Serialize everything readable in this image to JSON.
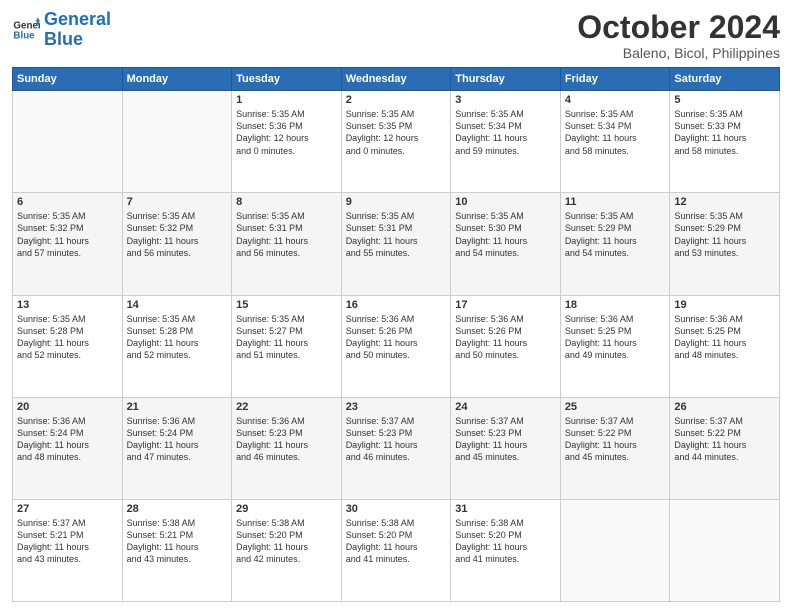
{
  "header": {
    "logo_line1": "General",
    "logo_line2": "Blue",
    "month": "October 2024",
    "location": "Baleno, Bicol, Philippines"
  },
  "weekdays": [
    "Sunday",
    "Monday",
    "Tuesday",
    "Wednesday",
    "Thursday",
    "Friday",
    "Saturday"
  ],
  "weeks": [
    [
      {
        "day": "",
        "text": ""
      },
      {
        "day": "",
        "text": ""
      },
      {
        "day": "1",
        "text": "Sunrise: 5:35 AM\nSunset: 5:36 PM\nDaylight: 12 hours\nand 0 minutes."
      },
      {
        "day": "2",
        "text": "Sunrise: 5:35 AM\nSunset: 5:35 PM\nDaylight: 12 hours\nand 0 minutes."
      },
      {
        "day": "3",
        "text": "Sunrise: 5:35 AM\nSunset: 5:34 PM\nDaylight: 11 hours\nand 59 minutes."
      },
      {
        "day": "4",
        "text": "Sunrise: 5:35 AM\nSunset: 5:34 PM\nDaylight: 11 hours\nand 58 minutes."
      },
      {
        "day": "5",
        "text": "Sunrise: 5:35 AM\nSunset: 5:33 PM\nDaylight: 11 hours\nand 58 minutes."
      }
    ],
    [
      {
        "day": "6",
        "text": "Sunrise: 5:35 AM\nSunset: 5:32 PM\nDaylight: 11 hours\nand 57 minutes."
      },
      {
        "day": "7",
        "text": "Sunrise: 5:35 AM\nSunset: 5:32 PM\nDaylight: 11 hours\nand 56 minutes."
      },
      {
        "day": "8",
        "text": "Sunrise: 5:35 AM\nSunset: 5:31 PM\nDaylight: 11 hours\nand 56 minutes."
      },
      {
        "day": "9",
        "text": "Sunrise: 5:35 AM\nSunset: 5:31 PM\nDaylight: 11 hours\nand 55 minutes."
      },
      {
        "day": "10",
        "text": "Sunrise: 5:35 AM\nSunset: 5:30 PM\nDaylight: 11 hours\nand 54 minutes."
      },
      {
        "day": "11",
        "text": "Sunrise: 5:35 AM\nSunset: 5:29 PM\nDaylight: 11 hours\nand 54 minutes."
      },
      {
        "day": "12",
        "text": "Sunrise: 5:35 AM\nSunset: 5:29 PM\nDaylight: 11 hours\nand 53 minutes."
      }
    ],
    [
      {
        "day": "13",
        "text": "Sunrise: 5:35 AM\nSunset: 5:28 PM\nDaylight: 11 hours\nand 52 minutes."
      },
      {
        "day": "14",
        "text": "Sunrise: 5:35 AM\nSunset: 5:28 PM\nDaylight: 11 hours\nand 52 minutes."
      },
      {
        "day": "15",
        "text": "Sunrise: 5:35 AM\nSunset: 5:27 PM\nDaylight: 11 hours\nand 51 minutes."
      },
      {
        "day": "16",
        "text": "Sunrise: 5:36 AM\nSunset: 5:26 PM\nDaylight: 11 hours\nand 50 minutes."
      },
      {
        "day": "17",
        "text": "Sunrise: 5:36 AM\nSunset: 5:26 PM\nDaylight: 11 hours\nand 50 minutes."
      },
      {
        "day": "18",
        "text": "Sunrise: 5:36 AM\nSunset: 5:25 PM\nDaylight: 11 hours\nand 49 minutes."
      },
      {
        "day": "19",
        "text": "Sunrise: 5:36 AM\nSunset: 5:25 PM\nDaylight: 11 hours\nand 48 minutes."
      }
    ],
    [
      {
        "day": "20",
        "text": "Sunrise: 5:36 AM\nSunset: 5:24 PM\nDaylight: 11 hours\nand 48 minutes."
      },
      {
        "day": "21",
        "text": "Sunrise: 5:36 AM\nSunset: 5:24 PM\nDaylight: 11 hours\nand 47 minutes."
      },
      {
        "day": "22",
        "text": "Sunrise: 5:36 AM\nSunset: 5:23 PM\nDaylight: 11 hours\nand 46 minutes."
      },
      {
        "day": "23",
        "text": "Sunrise: 5:37 AM\nSunset: 5:23 PM\nDaylight: 11 hours\nand 46 minutes."
      },
      {
        "day": "24",
        "text": "Sunrise: 5:37 AM\nSunset: 5:23 PM\nDaylight: 11 hours\nand 45 minutes."
      },
      {
        "day": "25",
        "text": "Sunrise: 5:37 AM\nSunset: 5:22 PM\nDaylight: 11 hours\nand 45 minutes."
      },
      {
        "day": "26",
        "text": "Sunrise: 5:37 AM\nSunset: 5:22 PM\nDaylight: 11 hours\nand 44 minutes."
      }
    ],
    [
      {
        "day": "27",
        "text": "Sunrise: 5:37 AM\nSunset: 5:21 PM\nDaylight: 11 hours\nand 43 minutes."
      },
      {
        "day": "28",
        "text": "Sunrise: 5:38 AM\nSunset: 5:21 PM\nDaylight: 11 hours\nand 43 minutes."
      },
      {
        "day": "29",
        "text": "Sunrise: 5:38 AM\nSunset: 5:20 PM\nDaylight: 11 hours\nand 42 minutes."
      },
      {
        "day": "30",
        "text": "Sunrise: 5:38 AM\nSunset: 5:20 PM\nDaylight: 11 hours\nand 41 minutes."
      },
      {
        "day": "31",
        "text": "Sunrise: 5:38 AM\nSunset: 5:20 PM\nDaylight: 11 hours\nand 41 minutes."
      },
      {
        "day": "",
        "text": ""
      },
      {
        "day": "",
        "text": ""
      }
    ]
  ]
}
